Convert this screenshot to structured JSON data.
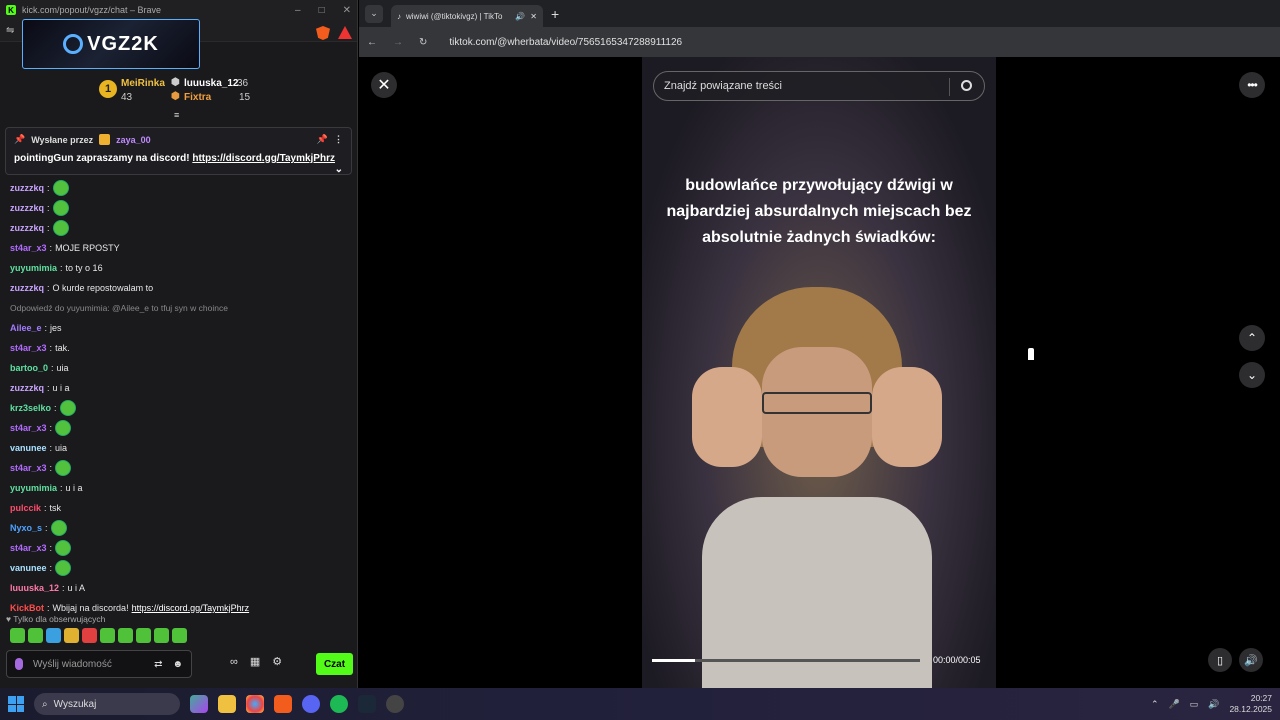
{
  "left_window": {
    "title": "kick.com/popout/vgzz/chat – Brave",
    "channel_logo": "VGZ2K",
    "leaderboard": [
      {
        "rank": "1",
        "name": "MeiRinka",
        "count": "43"
      },
      {
        "name": "luuuska_12",
        "count": "36"
      },
      {
        "name": "Fixtra",
        "count": "15"
      }
    ],
    "pinned": {
      "label": "Wysłane przez",
      "sender": "zaya_00",
      "text": "pointingGun zapraszamy na discord!",
      "link": "https://discord.gg/TaymkjPhrz",
      "top_cut": "yuyumimia: @Ailee_e to tfuj syn w choince"
    },
    "messages": [
      {
        "user": "zuzzzkq",
        "color": "#c9a4ff",
        "text": ""
      },
      {
        "user": "zuzzzkq",
        "color": "#c9a4ff",
        "text": ""
      },
      {
        "user": "zuzzzkq",
        "color": "#c9a4ff",
        "text": ""
      },
      {
        "user": "st4ar_x3",
        "color": "#b36bff",
        "text": "MOJE RPOSTY"
      },
      {
        "user": "yuyumimia",
        "color": "#5ee0a0",
        "text": "to ty o 16"
      },
      {
        "user": "zuzzzkq",
        "color": "#c9a4ff",
        "text": "O kurde repostowalam to"
      },
      {
        "reply": "Odpowiedź do yuyumimia: @Ailee_e to tfuj syn w choince"
      },
      {
        "user": "Ailee_e",
        "color": "#a27cff",
        "text": "jes"
      },
      {
        "user": "st4ar_x3",
        "color": "#b36bff",
        "text": "tak."
      },
      {
        "user": "bartoo_0",
        "color": "#5ee0a0",
        "text": "uia"
      },
      {
        "user": "zuzzzkq",
        "color": "#c9a4ff",
        "text": "u i a"
      },
      {
        "user": "krz3selko",
        "color": "#5ee0a0",
        "text": ""
      },
      {
        "user": "st4ar_x3",
        "color": "#b36bff",
        "text": ""
      },
      {
        "user": "vanunee",
        "color": "#a8e0ff",
        "text": "uia"
      },
      {
        "user": "st4ar_x3",
        "color": "#b36bff",
        "text": ""
      },
      {
        "user": "yuyumimia",
        "color": "#5ee0a0",
        "text": "u i a"
      },
      {
        "user": "pulccik",
        "color": "#ff4d6d",
        "text": "tsk"
      },
      {
        "user": "Nyxo_s",
        "color": "#4ea2ff",
        "text": ""
      },
      {
        "user": "st4ar_x3",
        "color": "#b36bff",
        "text": ""
      },
      {
        "user": "vanunee",
        "color": "#a8e0ff",
        "text": ""
      },
      {
        "user": "luuuska_12",
        "color": "#ff7aa8",
        "text": "u i A"
      },
      {
        "user": "KickBot",
        "color": "#ff4d4d",
        "text": "Wbijaj na discorda!",
        "link": "https://discord.gg/TaymkjPhrz"
      }
    ],
    "followers_only": "Tylko dla obserwujących",
    "input_placeholder": "Wyślij wiadomość",
    "send_label": "Czat"
  },
  "browser": {
    "tab_title": "wiwiwi (@tiktokivgz) | TikTo",
    "url": "tiktok.com/@wherbata/video/7565165347288911126",
    "search_placeholder": "Znajdź powiązane treści",
    "caption": "budowlańce przywołujący dźwigi w najbardziej absurdalnych miejscach bez absolutnie żadnych świadków:",
    "time": "00:00/00:05",
    "progress": 0.16
  },
  "taskbar": {
    "search": "Wyszukaj",
    "time": "20:27",
    "date": "28.12.2025"
  }
}
